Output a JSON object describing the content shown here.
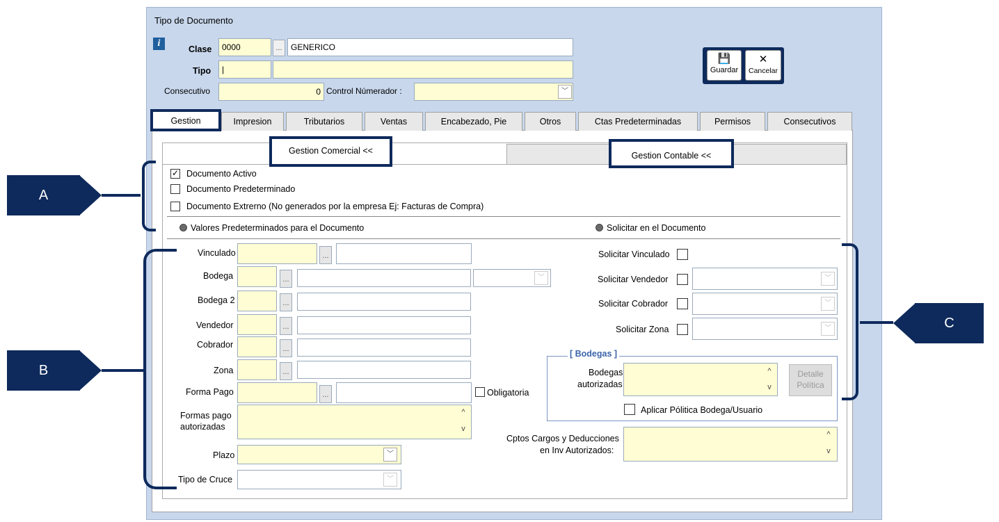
{
  "window": {
    "title": "Tipo de Documento"
  },
  "header": {
    "clase_label": "Clase",
    "clase_code": "0000",
    "clase_name": "GENERICO",
    "tipo_label": "Tipo",
    "tipo_code": "|",
    "consecutivo_label": "Consecutivo",
    "consecutivo_value": "0",
    "control_label": "Control Númerador :",
    "ellipsis": "...",
    "info_icon": "i"
  },
  "toolbar": {
    "save_label": "Guardar",
    "cancel_label": "Cancelar",
    "save_icon": "💾",
    "cancel_icon": "✕"
  },
  "tabs": [
    "Gestion",
    "Impresion",
    "Tributarios",
    "Ventas",
    "Encabezado, Pie",
    "Otros",
    "Ctas Predeterminadas",
    "Permisos",
    "Consecutivos"
  ],
  "subtabs": {
    "comercial": "Gestion Comercial <<",
    "contable": "Gestion Contable <<"
  },
  "checks": {
    "activo": {
      "label": "Documento Activo",
      "checked": true
    },
    "predeterminado": {
      "label": "Documento Predeterminado",
      "checked": false
    },
    "externo": {
      "label": "Documento Extrerno (No generados por la empresa  Ej: Facturas de Compra)",
      "checked": false
    }
  },
  "sections": {
    "valores": "Valores Predeterminados para el Documento",
    "solicitar": "Solicitar en el Documento"
  },
  "left": {
    "vinculado": "Vinculado",
    "bodega": "Bodega",
    "bodega2": "Bodega 2",
    "vendedor": "Vendedor",
    "cobrador": "Cobrador",
    "zona": "Zona",
    "forma_pago": "Forma Pago",
    "obligatoria": "Obligatoria",
    "formas_pago_1": "Formas pago",
    "formas_pago_2": "autorizadas",
    "plazo": "Plazo",
    "tipo_cruce": "Tipo de Cruce"
  },
  "right": {
    "sol_vinculado": "Solicitar Vinculado",
    "sol_vendedor": "Solicitar Vendedor",
    "sol_cobrador": "Solicitar Cobrador",
    "sol_zona": "Solicitar Zona",
    "bodegas_title": "[ Bodegas ]",
    "bodegas_aut_1": "Bodegas",
    "bodegas_aut_2": "autorizadas",
    "detalle_1": "Detalle",
    "detalle_2": "Política",
    "aplicar": "Aplicar Pólitica Bodega/Usuario",
    "cptos_1": "Cptos Cargos y Deducciones",
    "cptos_2": "en Inv Autorizados:"
  },
  "callouts": {
    "a": "A",
    "b": "B",
    "c": "C"
  },
  "symbols": {
    "check": "✓",
    "down": "﹀",
    "up": "︿",
    "scroll_up": "^",
    "scroll_down": "v"
  },
  "colors": {
    "accent": "#0e2a5c",
    "field_bg": "#fffdd4",
    "window_bg": "#c8d7ec"
  }
}
